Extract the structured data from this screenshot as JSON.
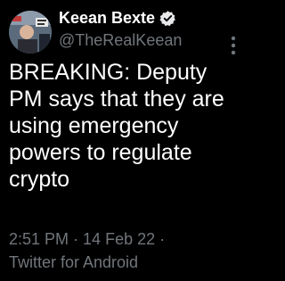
{
  "user": {
    "display_name": "Keean Bexte",
    "handle": "@TheRealKeean"
  },
  "tweet": {
    "text": "BREAKING: Deputy PM says that they are using emergency powers to regulate crypto",
    "time": "2:51 PM",
    "date": "14 Feb 22",
    "separator": " · ",
    "client": "Twitter for Android"
  },
  "colors": {
    "background": "#000000",
    "text": "#ffffff",
    "secondary": "#71767b",
    "verified_badge": "#e7e9ea"
  },
  "icons": {
    "verified": "verified-badge-icon",
    "more": "more-options-icon"
  }
}
